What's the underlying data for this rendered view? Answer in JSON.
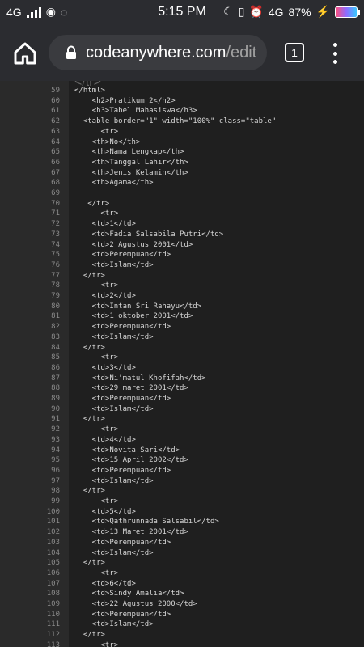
{
  "status": {
    "network": "4G",
    "time": "5:15 PM",
    "network2": "4G",
    "battery": "87%"
  },
  "browser": {
    "url_host": "codeanywhere.com",
    "url_path": "/editor",
    "tab_count": "1"
  },
  "editor": {
    "lines": [
      {
        "n": "59",
        "t": "</html>"
      },
      {
        "n": "60",
        "t": "    <h2>Pratikum 2</h2>"
      },
      {
        "n": "61",
        "t": "    <h3>Tabel Mahasiswa</h3>"
      },
      {
        "n": "62",
        "t": "  <table border=\"1\" width=\"100%\" class=\"table\""
      },
      {
        "n": "63",
        "t": "      <tr>"
      },
      {
        "n": "64",
        "t": "    <th>No</th>"
      },
      {
        "n": "65",
        "t": "    <th>Nama Lengkap</th>"
      },
      {
        "n": "66",
        "t": "    <th>Tanggal Lahir</th>"
      },
      {
        "n": "67",
        "t": "    <th>Jenis Kelamin</th>"
      },
      {
        "n": "68",
        "t": "    <th>Agama</th>"
      },
      {
        "n": "69",
        "t": ""
      },
      {
        "n": "70",
        "t": "   </tr>"
      },
      {
        "n": "71",
        "t": "      <tr>"
      },
      {
        "n": "72",
        "t": "    <td>1</td>"
      },
      {
        "n": "73",
        "t": "    <td>Fadia Salsabila Putri</td>"
      },
      {
        "n": "74",
        "t": "    <td>2 Agustus 2001</td>"
      },
      {
        "n": "75",
        "t": "    <td>Perempuan</td>"
      },
      {
        "n": "76",
        "t": "    <td>Islam</td>"
      },
      {
        "n": "77",
        "t": "  </tr>"
      },
      {
        "n": "78",
        "t": "      <tr>"
      },
      {
        "n": "79",
        "t": "    <td>2</td>"
      },
      {
        "n": "80",
        "t": "    <td>Intan Sri Rahayu</td>"
      },
      {
        "n": "81",
        "t": "    <td>1 oktober 2001</td>"
      },
      {
        "n": "82",
        "t": "    <td>Perempuan</td>"
      },
      {
        "n": "83",
        "t": "    <td>Islam</td>"
      },
      {
        "n": "84",
        "t": "  </tr>"
      },
      {
        "n": "85",
        "t": "      <tr>"
      },
      {
        "n": "86",
        "t": "    <td>3</td>"
      },
      {
        "n": "87",
        "t": "    <td>Ni'matul Khofifah</td>"
      },
      {
        "n": "88",
        "t": "    <td>29 maret 2001</td>"
      },
      {
        "n": "89",
        "t": "    <td>Perempuan</td>"
      },
      {
        "n": "90",
        "t": "    <td>Islam</td>"
      },
      {
        "n": "91",
        "t": "  </tr>"
      },
      {
        "n": "92",
        "t": "      <tr>"
      },
      {
        "n": "93",
        "t": "    <td>4</td>"
      },
      {
        "n": "94",
        "t": "    <td>Novita Sari</td>"
      },
      {
        "n": "95",
        "t": "    <td>15 April 2002</td>"
      },
      {
        "n": "96",
        "t": "    <td>Perempuan</td>"
      },
      {
        "n": "97",
        "t": "    <td>Islam</td>"
      },
      {
        "n": "98",
        "t": "  </tr>"
      },
      {
        "n": "99",
        "t": "      <tr>"
      },
      {
        "n": "100",
        "t": "    <td>5</td>"
      },
      {
        "n": "101",
        "t": "    <td>Qathrunnada Salsabil</td>"
      },
      {
        "n": "102",
        "t": "    <td>13 Maret 2001</td>"
      },
      {
        "n": "103",
        "t": "    <td>Perempuan</td>"
      },
      {
        "n": "104",
        "t": "    <td>Islam</td>"
      },
      {
        "n": "105",
        "t": "  </tr>"
      },
      {
        "n": "106",
        "t": "      <tr>"
      },
      {
        "n": "107",
        "t": "    <td>6</td>"
      },
      {
        "n": "108",
        "t": "    <td>Sindy Amalia</td>"
      },
      {
        "n": "109",
        "t": "    <td>22 Agustus 2000</td>"
      },
      {
        "n": "110",
        "t": "    <td>Perempuan</td>"
      },
      {
        "n": "111",
        "t": "    <td>Islam</td>"
      },
      {
        "n": "112",
        "t": "  </tr>"
      },
      {
        "n": "113",
        "t": "      <tr>"
      }
    ]
  },
  "colors": {
    "background": "#1f1f1f",
    "gutter": "#2a2a2a",
    "text": "#d7d7d7",
    "attr": "#e6db74"
  }
}
